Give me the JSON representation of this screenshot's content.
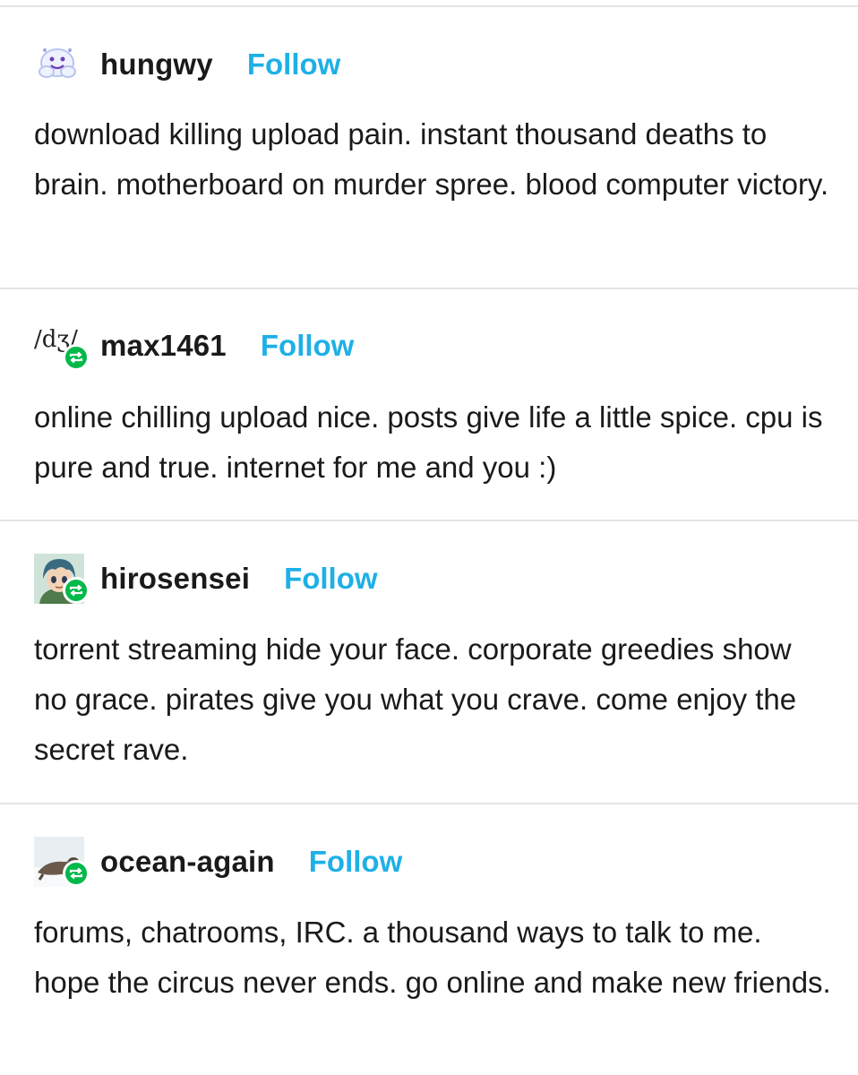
{
  "posts": [
    {
      "username": "hungwy",
      "follow_label": "Follow",
      "avatar_icon": "ghost-avatar-icon",
      "reblogged": false,
      "body": "download killing upload pain. instant thousand deaths to brain. motherboard on murder spree. blood computer victory."
    },
    {
      "username": "max1461",
      "follow_label": "Follow",
      "avatar_icon": "ipa-text-avatar-icon",
      "avatar_text": "/dʒ/",
      "reblogged": true,
      "body": "online chilling upload nice. posts give life a little spice. cpu is pure and true. internet for me and you :)"
    },
    {
      "username": "hirosensei",
      "follow_label": "Follow",
      "avatar_icon": "anime-character-avatar-icon",
      "reblogged": true,
      "body": "torrent streaming hide your face. corporate greedies show no grace. pirates give you what you crave. come enjoy the secret rave."
    },
    {
      "username": "ocean-again",
      "follow_label": "Follow",
      "avatar_icon": "seal-avatar-icon",
      "reblogged": true,
      "body": "forums, chatrooms, IRC. a thousand ways to talk to me. hope the circus never ends. go online and make new friends."
    }
  ],
  "colors": {
    "follow": "#1eb0e6",
    "reblog_badge": "#00b94a",
    "divider": "#e4e4e4",
    "text": "#1a1a1a"
  }
}
